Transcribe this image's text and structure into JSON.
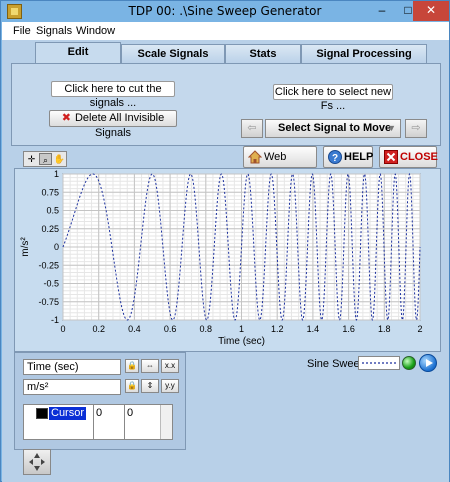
{
  "window": {
    "title": "TDP 00: .\\Sine Sweep Generator",
    "minimize": "–",
    "maximize": "□",
    "close": "✕"
  },
  "menu": [
    "File",
    "Signals",
    "Window"
  ],
  "tabs": [
    {
      "label": "Edit",
      "active": true
    },
    {
      "label": "Scale Signals",
      "active": false
    },
    {
      "label": "Stats",
      "active": false
    },
    {
      "label": "Signal Processing",
      "active": false
    }
  ],
  "edit_panel": {
    "cut_button": "Click here to cut the signals ...",
    "fs_button": "Click here to select new Fs ...",
    "delete_button": "Delete All Invisible Signals",
    "select_signal": "Select Signal to Move ...",
    "prev_arrow": "⇦",
    "next_arrow": "⇨"
  },
  "toolbar": {
    "web_home": "Web Home",
    "help": "HELP",
    "close": "CLOSE"
  },
  "graph": {
    "x_axis_name": "Time (sec)",
    "y_axis_name": "m/s²",
    "legend": "Sine Sweep",
    "line_color": "#1a2f9e"
  },
  "chart_data": {
    "type": "line",
    "title": "",
    "xlabel": "Time (sec)",
    "ylabel": "m/s²",
    "xlim": [
      0,
      2
    ],
    "ylim": [
      -1,
      1
    ],
    "x_ticks": [
      "0",
      "0.2",
      "0.4",
      "0.6",
      "0.8",
      "1",
      "1.2",
      "1.4",
      "1.6",
      "1.8",
      "2"
    ],
    "y_ticks": [
      "1",
      "0.75",
      "0.5",
      "0.25",
      "0",
      "-0.25",
      "-0.5",
      "-0.75",
      "-1"
    ],
    "grid": true,
    "series": [
      {
        "name": "Sine Sweep",
        "style": "dotted",
        "color": "#1a2f9e",
        "start_freq_hz": 1.0,
        "end_freq_hz": 13.0
      }
    ]
  },
  "cursor": {
    "name": "Cursor",
    "x": "0",
    "y": "0"
  }
}
